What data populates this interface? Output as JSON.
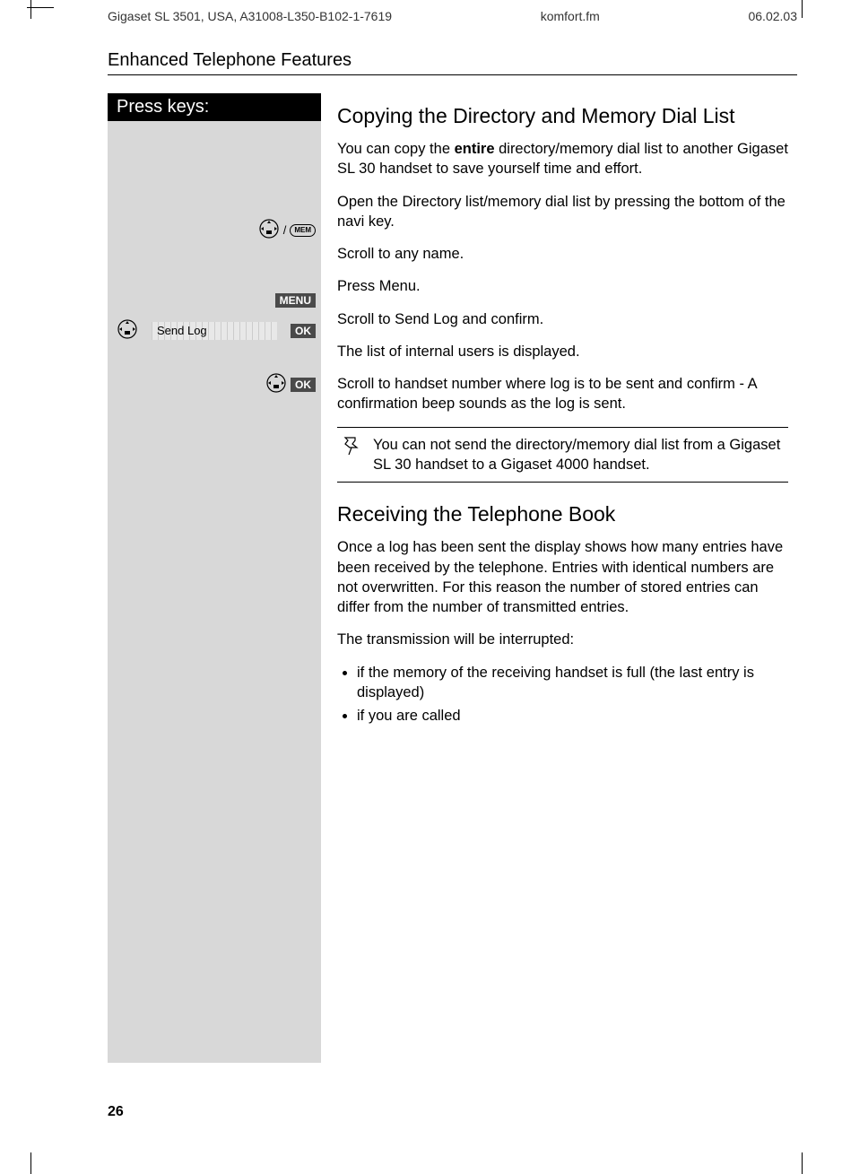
{
  "header": {
    "left": "Gigaset SL 3501, USA, A31008-L350-B102-1-7619",
    "middle": "komfort.fm",
    "right": "06.02.03"
  },
  "section_title": "Enhanced Telephone Features",
  "press_keys_label": "Press keys:",
  "keys": {
    "slash": "/",
    "mem_label": "MEM",
    "menu_label": "MENU",
    "ok_label": "OK",
    "send_log_label": "Send Log"
  },
  "content": {
    "h_copy": "Copying the Directory and Memory Dial List",
    "p_copy_pre": "You can copy the ",
    "p_copy_bold": "entire",
    "p_copy_post": " directory/memory dial list  to another Gigaset SL 30 handset to save yourself time and effort.",
    "p_open": "Open the Directory list/memory dial list by pressing the bottom of the navi key.",
    "p_scroll_name": "Scroll to any name.",
    "p_press_menu": "Press Menu.",
    "p_scroll_send": "Scroll to Send Log and confirm.",
    "p_internal_users": "The list of internal users is displayed.",
    "p_scroll_handset": "Scroll to handset number where log is to be sent and confirm - A confirmation beep sounds as the log is sent.",
    "note": "You can not send the directory/memory dial list from a Gigaset SL 30 handset to a Gigaset  4000 handset.",
    "h_receive": "Receiving the Telephone Book",
    "p_receive1": "Once a log has been sent the display shows how many entries have been received by the telephone. Entries with identical numbers are not overwritten.  For this reason the number of stored entries can differ from the number of transmitted entries.",
    "p_receive2": "The transmission will be interrupted:",
    "bullets": [
      "if the memory of the receiving handset is full (the last entry is displayed)",
      "if you are called"
    ]
  },
  "page_number": "26"
}
